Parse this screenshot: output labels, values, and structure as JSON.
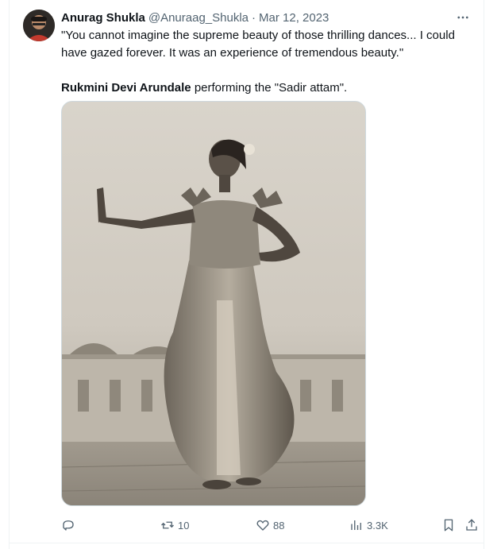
{
  "tweet": {
    "author_name": "Anurag Shukla",
    "author_handle": "@Anuraag_Shukla",
    "separator": "·",
    "date": "Mar 12, 2023",
    "text_line1": "\"You cannot imagine the supreme beauty of those thrilling dances... I could have gazed forever. It was an experience of tremendous beauty.\"",
    "text_bold": "Rukmini Devi Arundale",
    "text_rest": " performing the \"Sadir attam\"."
  },
  "actions": {
    "reply_count": "",
    "retweet_count": "10",
    "like_count": "88",
    "views_count": "3.3K"
  },
  "icons": {
    "more": "more-icon",
    "reply": "reply-icon",
    "retweet": "retweet-icon",
    "like": "heart-icon",
    "views": "views-icon",
    "bookmark": "bookmark-icon",
    "share": "share-icon"
  },
  "colors": {
    "text": "#0f1419",
    "secondary": "#536471",
    "border": "#eff3f4"
  }
}
